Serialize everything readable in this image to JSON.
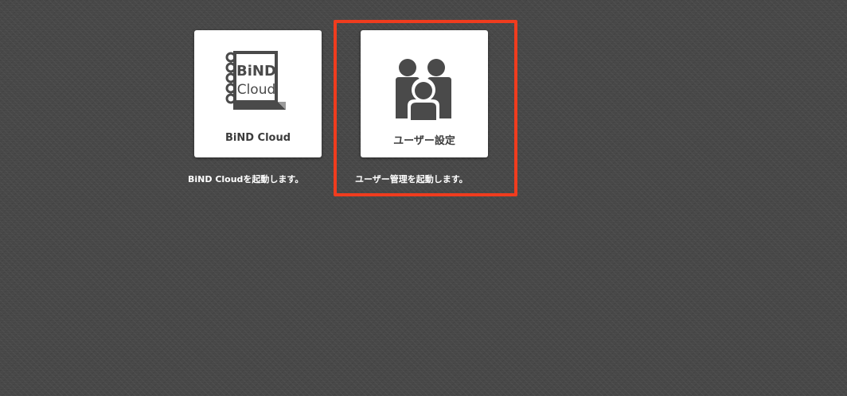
{
  "apps": [
    {
      "id": "bind-cloud",
      "label": "BiND Cloud",
      "description": "BiND Cloudを起動します。",
      "icon": "bind-cloud-logo-icon",
      "logo_lines": [
        "BiND",
        "Cloud"
      ]
    },
    {
      "id": "user-settings",
      "label": "ユーザー設定",
      "description": "ユーザー管理を起動します。",
      "icon": "users-group-icon"
    }
  ],
  "colors": {
    "background": "#474747",
    "tile": "#ffffff",
    "icon": "#4a4a4a",
    "highlight": "#f03c1e",
    "description_text": "#ffffff"
  }
}
